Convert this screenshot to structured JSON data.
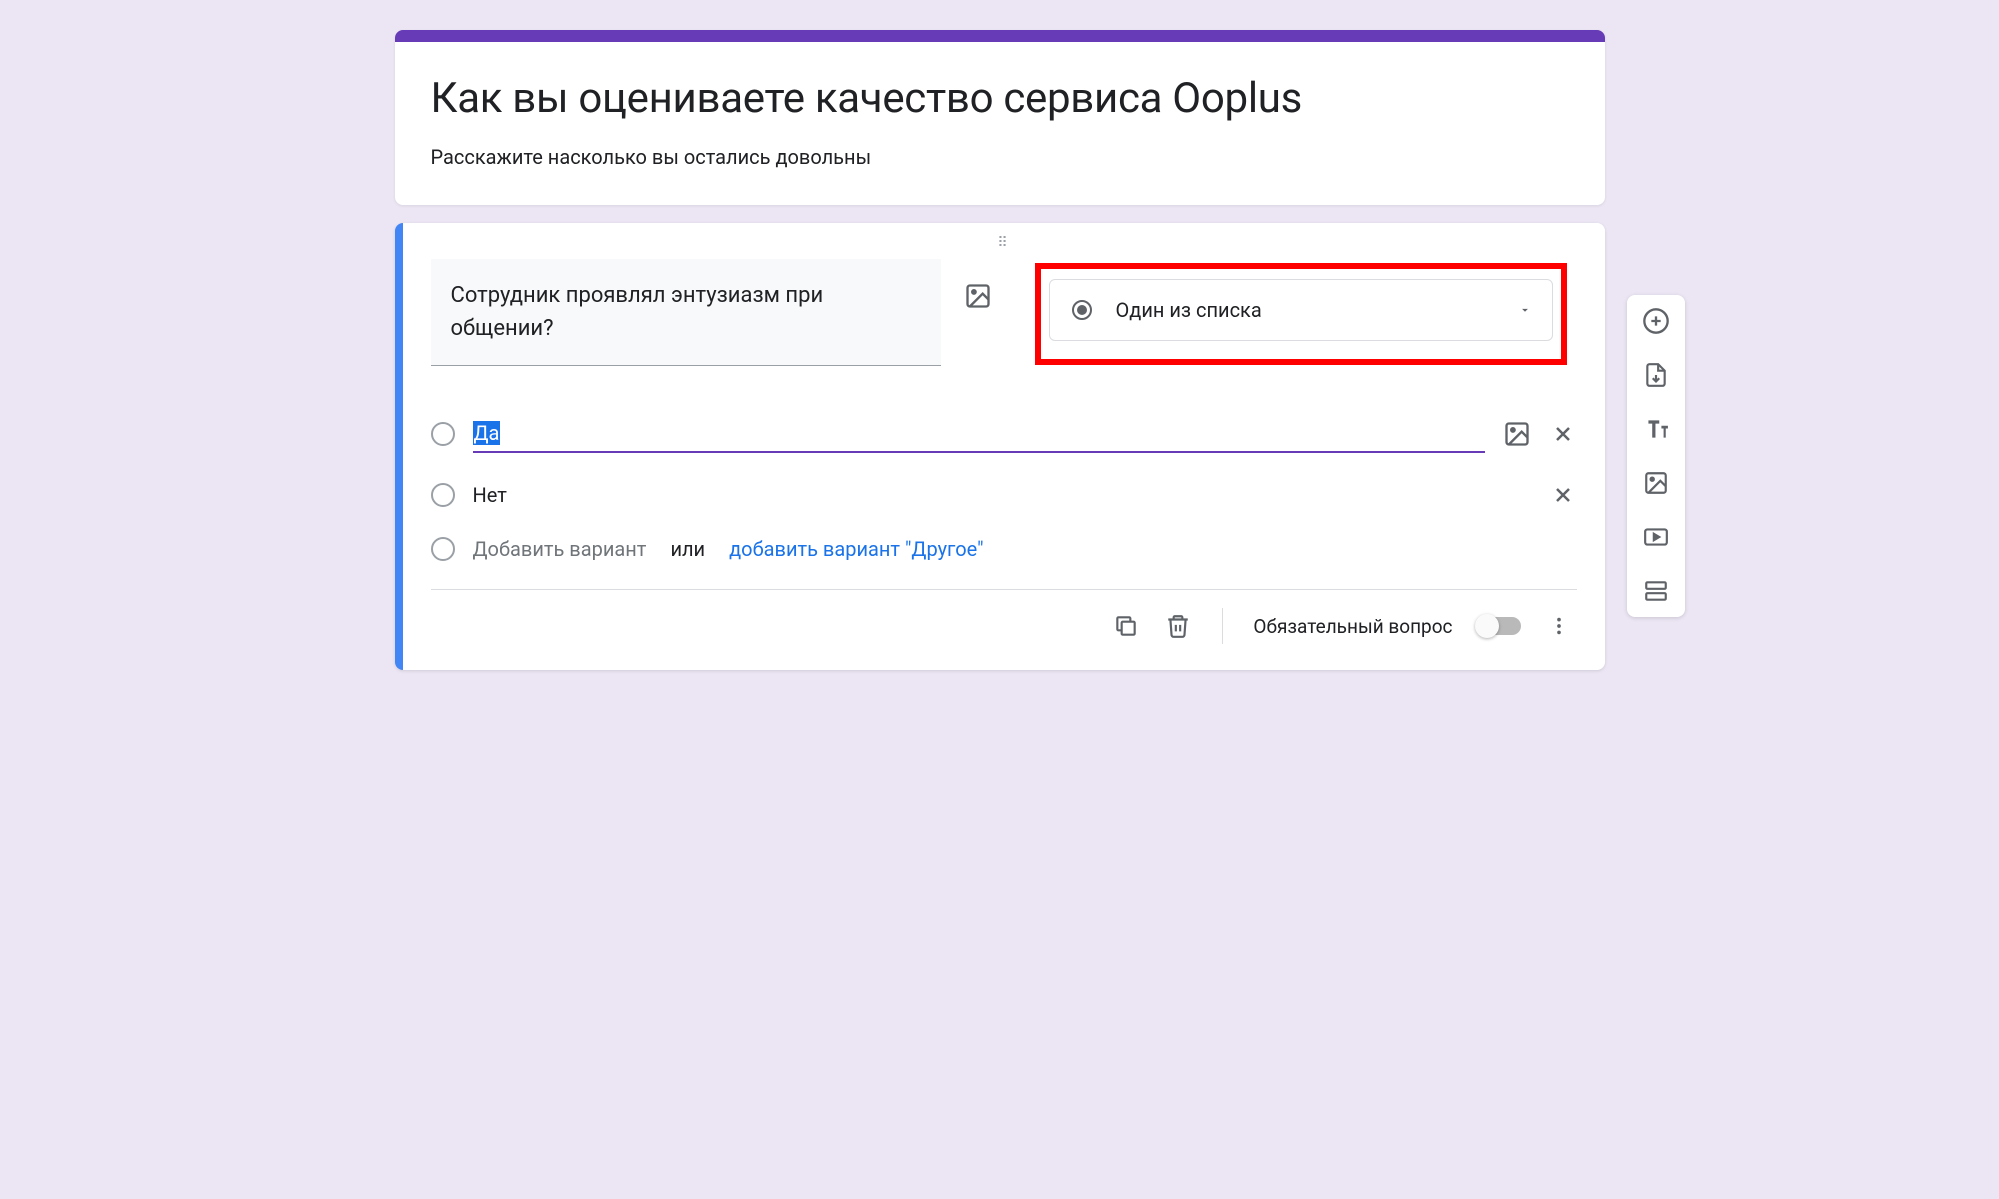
{
  "header": {
    "title": "Как вы оцениваете качество сервиса Ooplus",
    "description": "Расскажите насколько вы остались довольны"
  },
  "question": {
    "text": "Сотрудник проявлял энтузиазм при общении?",
    "type_label": "Один из списка",
    "options": [
      {
        "label": "Да",
        "focused": true,
        "has_image_btn": true
      },
      {
        "label": "Нет",
        "focused": false,
        "has_image_btn": false
      }
    ],
    "add_option_placeholder": "Добавить вариант",
    "or_text": "или",
    "add_other_label": "добавить вариант \"Другое\"",
    "required_label": "Обязательный вопрос"
  }
}
